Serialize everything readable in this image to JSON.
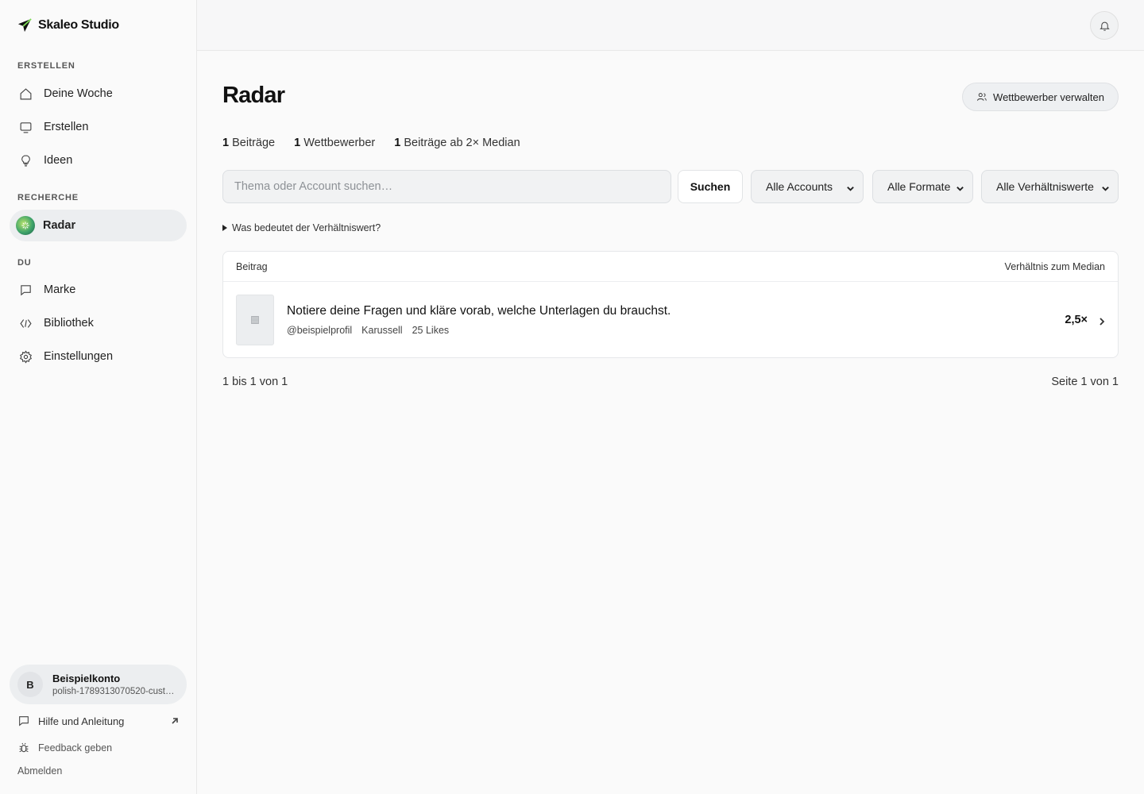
{
  "app": {
    "name": "Skaleo Studio",
    "accent": "#3ea36a"
  },
  "sidebar": {
    "sections": [
      {
        "label": "ERSTELLEN",
        "items": [
          {
            "label": "Deine Woche",
            "icon": "home-icon"
          },
          {
            "label": "Erstellen",
            "icon": "monitor-icon"
          },
          {
            "label": "Ideen",
            "icon": "lightbulb-icon"
          }
        ]
      },
      {
        "label": "RECHERCHE",
        "items": [
          {
            "label": "Radar",
            "icon": "radar-icon",
            "active": true
          }
        ]
      },
      {
        "label": "DU",
        "items": [
          {
            "label": "Marke",
            "icon": "message-square-icon"
          },
          {
            "label": "Bibliothek",
            "icon": "code-icon"
          },
          {
            "label": "Einstellungen",
            "icon": "gear-icon"
          }
        ]
      }
    ],
    "account": {
      "initial": "B",
      "name": "Beispielkonto",
      "sub": "polish-1789313070520-customer"
    },
    "footer": {
      "help": "Hilfe und Anleitung",
      "feedback": "Feedback geben",
      "logout": "Abmelden"
    }
  },
  "main": {
    "title": "Radar",
    "manage_button": "Wettbewerber verwalten",
    "stats": [
      {
        "count": "1",
        "label": "Beiträge"
      },
      {
        "count": "1",
        "label": "Wettbewerber"
      },
      {
        "count": "1",
        "label": "Beiträge ab 2× Median"
      }
    ],
    "search": {
      "placeholder": "Thema oder Account suchen…",
      "button": "Suchen"
    },
    "filters": {
      "accounts": "Alle Accounts",
      "formats": "Alle Formate",
      "ratios": "Alle Verhältniswerte"
    },
    "disclosure": "Was bedeutet der Verhältniswert?",
    "table": {
      "col_post": "Beitrag",
      "col_ratio": "Verhältnis zum Median",
      "rows": [
        {
          "title": "Notiere deine Fragen und kläre vorab, welche Unterlagen du brauchst.",
          "account": "@beispielprofil",
          "format": "Karussell",
          "likes": "25 Likes",
          "ratio": "2,5×"
        }
      ]
    },
    "pager": {
      "range": "1 bis 1 von 1",
      "page": "Seite 1 von 1"
    }
  }
}
